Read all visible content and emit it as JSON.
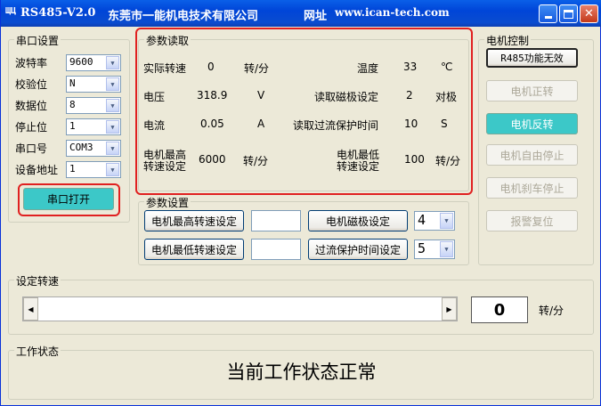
{
  "window": {
    "title_prefix": "RS485-V2.0",
    "title_company": "东莞市一能机电技术有限公司",
    "title_site_label": "网址",
    "title_site_url": "www.ican-tech.com"
  },
  "serial": {
    "legend": "串口设置",
    "rows": [
      {
        "label": "波特率",
        "value": "9600"
      },
      {
        "label": "校验位",
        "value": "N"
      },
      {
        "label": "数据位",
        "value": "8"
      },
      {
        "label": "停止位",
        "value": "1"
      },
      {
        "label": "串口号",
        "value": "COM3"
      },
      {
        "label": "设备地址",
        "value": "1"
      }
    ],
    "open_button": "串口打开"
  },
  "read": {
    "legend": "参数读取",
    "actual_speed_label": "实际转速",
    "actual_speed_value": "0",
    "actual_speed_unit": "转/分",
    "temp_label": "温度",
    "temp_value": "33",
    "temp_unit": "℃",
    "voltage_label": "电压",
    "voltage_value": "318.9",
    "voltage_unit": "V",
    "poles_label": "读取磁极设定",
    "poles_value": "2",
    "poles_unit": "对极",
    "current_label": "电流",
    "current_value": "0.05",
    "current_unit": "A",
    "ocp_label": "读取过流保护时间",
    "ocp_value": "10",
    "ocp_unit": "S",
    "max_speed_label_1": "电机最高",
    "max_speed_label_2": "转速设定",
    "max_speed_value": "6000",
    "max_speed_unit": "转/分",
    "min_speed_label_1": "电机最低",
    "min_speed_label_2": "转速设定",
    "min_speed_value": "100",
    "min_speed_unit": "转/分"
  },
  "settings": {
    "legend": "参数设置",
    "max_speed_button": "电机最高转速设定",
    "min_speed_button": "电机最低转速设定",
    "poles_button": "电机磁极设定",
    "poles_value": "4",
    "ocp_button": "过流保护时间设定",
    "ocp_value": "5"
  },
  "control": {
    "legend": "电机控制",
    "rs485_button": "R485功能无效",
    "forward_button": "电机正转",
    "reverse_button": "电机反转",
    "free_stop_button": "电机自由停止",
    "brake_stop_button": "电机刹车停止",
    "alarm_reset_button": "报警复位"
  },
  "speed": {
    "legend": "设定转速",
    "value": "0",
    "unit": "转/分",
    "slider_fraction": 0
  },
  "status": {
    "legend": "工作状态",
    "text": "当前工作状态正常"
  },
  "colors": {
    "title_bar": "#0a4ccf",
    "highlight_red": "#e02020",
    "teal_button": "#3cc8c8"
  }
}
